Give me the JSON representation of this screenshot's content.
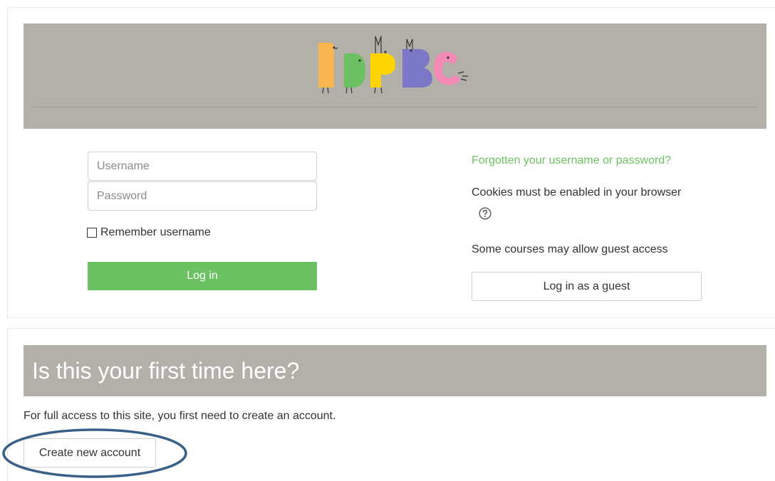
{
  "login": {
    "username_placeholder": "Username",
    "password_placeholder": "Password",
    "remember_label": "Remember username",
    "login_button": "Log in",
    "forgot_link": "Forgotten your username or password?",
    "cookies_text": "Cookies must be enabled in your browser",
    "guest_text": "Some courses may allow guest access",
    "guest_button": "Log in as a guest",
    "help_icon": "help-circle-icon"
  },
  "signup": {
    "title": "Is this your first time here?",
    "description": "For full access to this site, you first need to create an account.",
    "create_button": "Create new account"
  },
  "colors": {
    "banner": "#b3b0a9",
    "accent_green": "#6cc262",
    "highlight_ring": "#3a5f86"
  }
}
